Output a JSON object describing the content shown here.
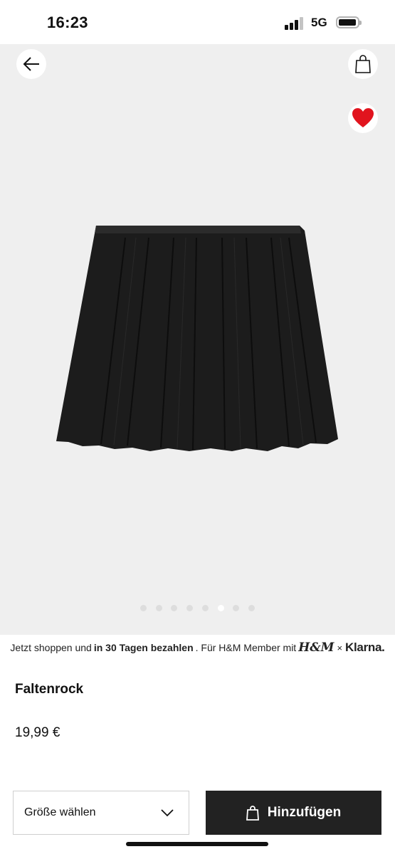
{
  "status_bar": {
    "time": "16:23",
    "network": "5G",
    "icons": [
      "signal-icon",
      "battery-icon"
    ]
  },
  "header": {
    "icons": [
      "arrow-left-icon",
      "shopping-bag-icon",
      "heart-icon"
    ],
    "favorite_color": "#e1141e"
  },
  "gallery": {
    "image": "black-pleated-skirt",
    "image_count": 8,
    "active_index": 5
  },
  "banner": {
    "text_1": "Jetzt shoppen und",
    "text_bold": "in 30 Tagen bezahlen",
    "text_2": ". Für H&M Member mit",
    "hm_logo": "H&M",
    "times": "×",
    "klarna_logo": "Klarna."
  },
  "product": {
    "title": "Faltenrock",
    "price": "19,99 €"
  },
  "size_select": {
    "label": "Größe wählen",
    "icon": "chevron-down-icon"
  },
  "add_button": {
    "label": "Hinzufügen",
    "icon": "shopping-bag-icon"
  }
}
